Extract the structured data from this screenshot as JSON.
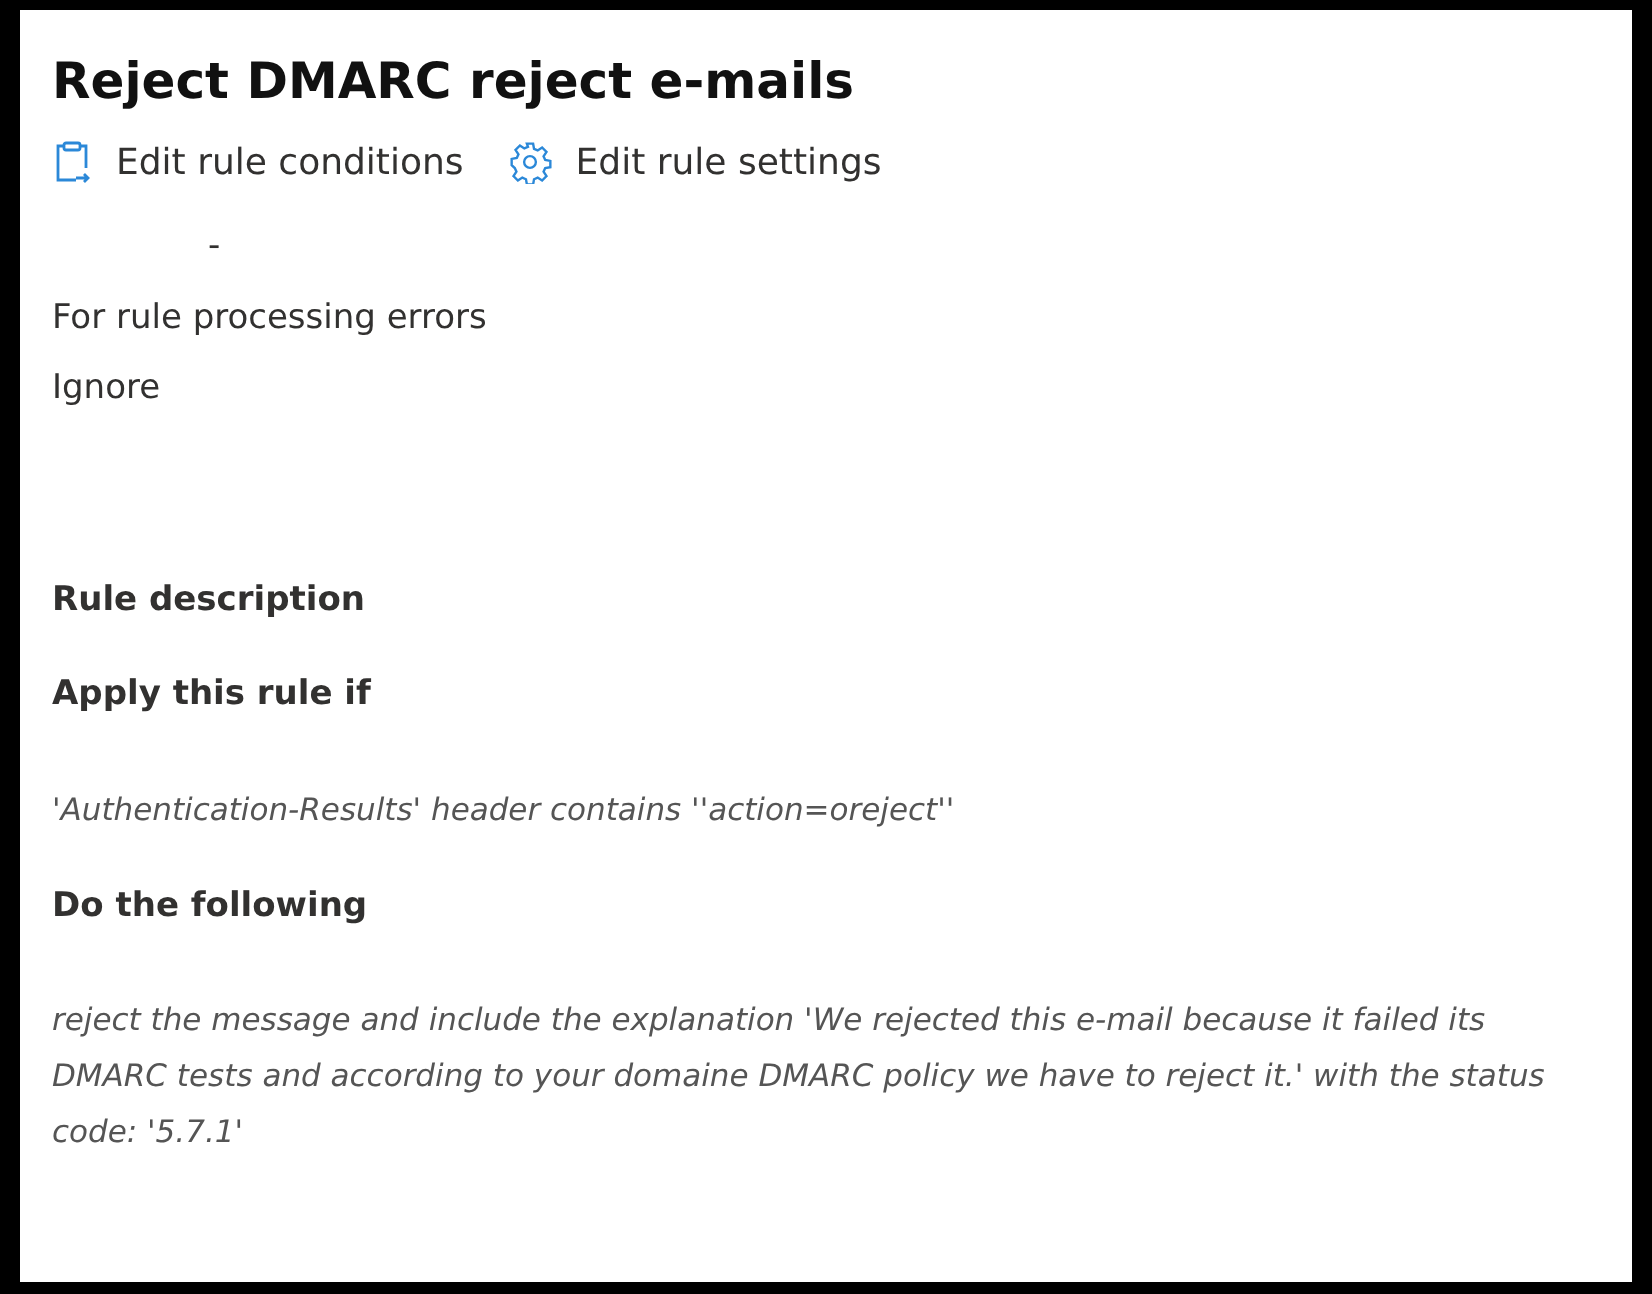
{
  "title": "Reject DMARC reject e-mails",
  "actions": [
    {
      "label": "Edit rule conditions",
      "kind": "clipboard"
    },
    {
      "label": "Edit rule settings",
      "kind": "gear"
    }
  ],
  "mode_value": "-",
  "errors": {
    "label": "For rule processing errors",
    "value": "Ignore"
  },
  "description": {
    "heading": "Rule description",
    "condition_label": "Apply this rule if",
    "condition": "'Authentication-Results' header contains ''action=oreject''",
    "action_label": "Do the following",
    "action": "reject the message and include the explanation 'We rejected this e-mail because it failed its DMARC tests and according to your domaine DMARC policy we have to reject it.' with the status code: '5.7.1'"
  }
}
